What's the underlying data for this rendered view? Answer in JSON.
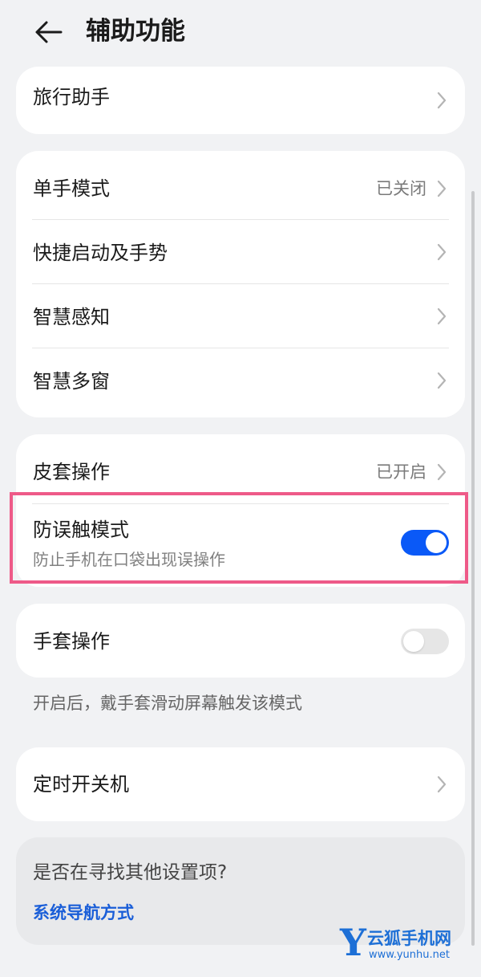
{
  "header": {
    "title": "辅助功能",
    "back_icon": "arrow-left-icon"
  },
  "group1": {
    "items": [
      {
        "label": "旅行助手"
      }
    ]
  },
  "group2": {
    "items": [
      {
        "label": "单手模式",
        "value": "已关闭"
      },
      {
        "label": "快捷启动及手势"
      },
      {
        "label": "智慧感知"
      },
      {
        "label": "智慧多窗"
      }
    ]
  },
  "group3": {
    "cover_ops": {
      "label": "皮套操作",
      "value": "已开启"
    },
    "anti_touch": {
      "label": "防误触模式",
      "sub": "防止手机在口袋出现误操作",
      "enabled": true
    }
  },
  "group4": {
    "glove_ops": {
      "label": "手套操作",
      "enabled": false
    },
    "note": "开启后，戴手套滑动屏幕触发该模式"
  },
  "group5": {
    "items": [
      {
        "label": "定时开关机"
      }
    ]
  },
  "suggest": {
    "title": "是否在寻找其他设置项?",
    "link": "系统导航方式"
  },
  "watermark": {
    "logo_letter": "Y",
    "name": "云狐手机网",
    "url": "www.yunhu.net"
  },
  "colors": {
    "accent": "#0a59f7",
    "highlight": "#ee5a88",
    "link": "#1a5ed8",
    "background": "#f1f2f4"
  }
}
